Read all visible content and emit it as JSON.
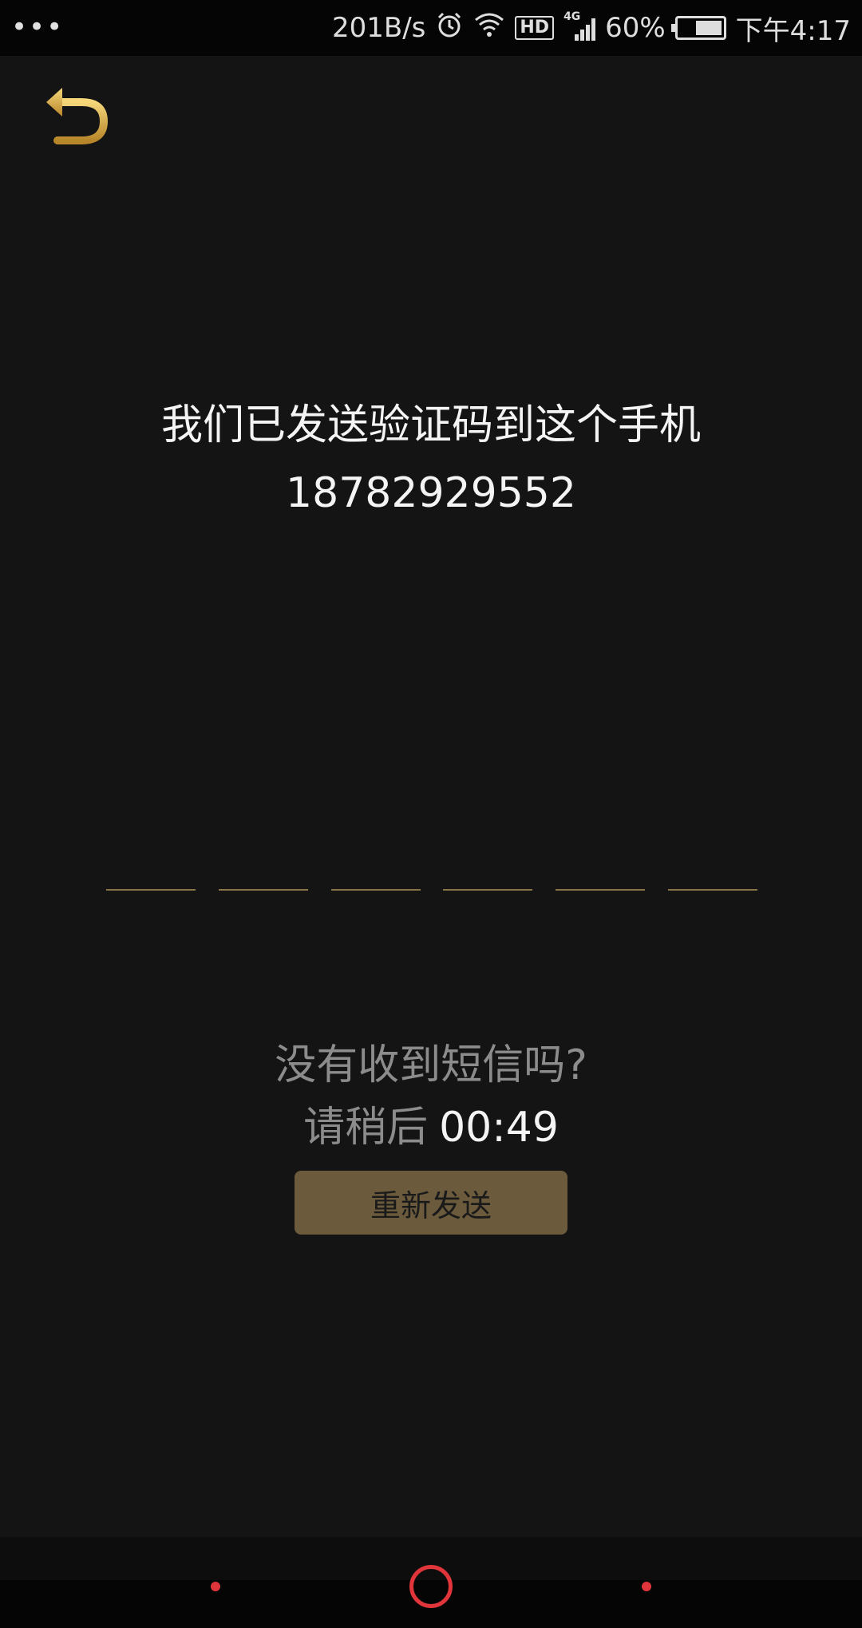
{
  "status_bar": {
    "menu_dots": "•••",
    "net_speed": "201B/s",
    "hd_label": "HD",
    "network_type": "4G",
    "battery_percent": "60%",
    "battery_level": 0.6,
    "time": "下午4:17",
    "icons": [
      "alarm-icon",
      "wifi-icon",
      "signal-icon",
      "battery-icon"
    ]
  },
  "back": {
    "icon": "back-arrow-icon",
    "color": "#d9b04a"
  },
  "message": {
    "headline": "我们已发送验证码到这个手机",
    "phone_number": "18782929552"
  },
  "code_input": {
    "length": 6,
    "values": [
      "",
      "",
      "",
      "",
      "",
      ""
    ]
  },
  "resend": {
    "hint": "没有收到短信吗?",
    "wait_label": "请稍后",
    "countdown": "00:49",
    "button_label": "重新发送"
  },
  "nav_bar": {
    "accent_color": "#e0353a",
    "items": [
      "back-dot",
      "home-circle",
      "menu-dot"
    ]
  },
  "colors": {
    "background": "#141414",
    "accent_gold": "#8a7548",
    "button_bg": "#6b5a3c"
  }
}
